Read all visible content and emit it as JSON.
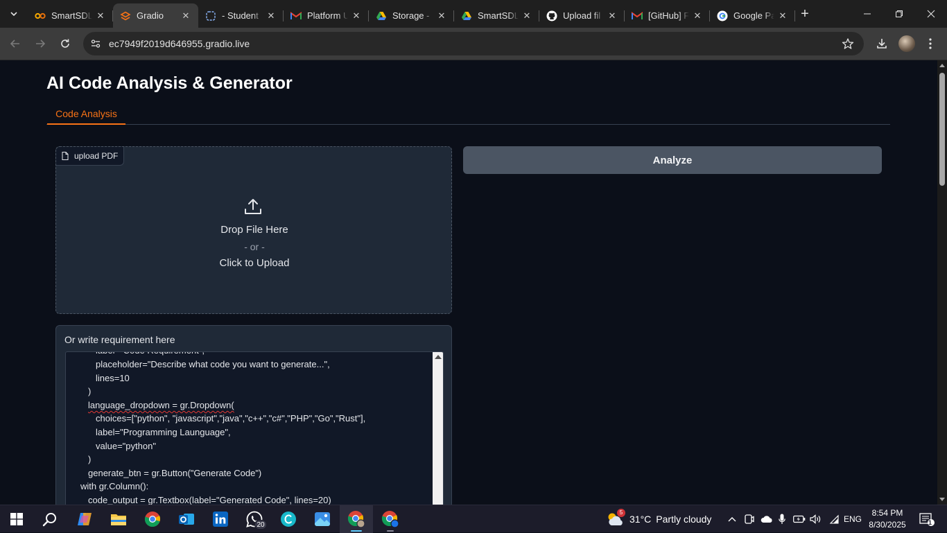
{
  "browser": {
    "tabs": [
      {
        "title": "SmartSDLC",
        "icon": "colab-icon"
      },
      {
        "title": "Gradio",
        "icon": "gradio-icon",
        "active": true
      },
      {
        "title": "- Student",
        "icon": "student-portal-icon"
      },
      {
        "title": "Platform U",
        "icon": "gmail-icon"
      },
      {
        "title": "Storage -",
        "icon": "google-drive-icon"
      },
      {
        "title": "SmartSDLC",
        "icon": "google-drive-icon"
      },
      {
        "title": "Upload fil",
        "icon": "github-icon"
      },
      {
        "title": "[GitHub] F",
        "icon": "gmail-icon"
      },
      {
        "title": "Google Pa",
        "icon": "google-pay-icon"
      }
    ],
    "url": "ec7949f2019d646955.gradio.live"
  },
  "app": {
    "title": "AI Code Analysis & Generator",
    "tabs": [
      {
        "label": "Code Analysis",
        "active": true
      }
    ],
    "upload": {
      "label": "upload PDF",
      "drop_text": "Drop File Here",
      "or_text": "- or -",
      "click_text": "Click to Upload"
    },
    "analyze_button": "Analyze",
    "requirement": {
      "label": "Or write requirement here",
      "lines": [
        "label=\"Code Requirement\",",
        "placeholder=\"Describe what code you want to generate...\",",
        "lines=10",
        ")",
        "language_dropdown = gr.Dropdown(",
        "choices=[\"python\", \"javascript\",\"java\",\"c++\",\"c#\",\"PHP\",\"Go\",\"Rust\"],",
        "label=\"Programming Launguage\",",
        "value=\"python\"",
        ")",
        "generate_btn = gr.Button(\"Generate Code\")",
        "with gr.Column():",
        "code_output = gr.Textbox(label=\"Generated Code\", lines=20)"
      ]
    }
  },
  "taskbar": {
    "apps": [
      "start-icon",
      "search-icon",
      "copilot-icon",
      "file-explorer-icon",
      "chrome-icon",
      "outlook-icon",
      "linkedin-icon",
      "whatsapp-icon",
      "canva-icon",
      "photos-icon",
      "chrome-profile-icon",
      "chrome-profile-2-icon"
    ],
    "whatsapp_badge": "20",
    "weather_badge": "5",
    "temperature": "31°C",
    "weather": "Partly cloudy",
    "language": "ENG",
    "time": "8:54 PM",
    "date": "8/30/2025",
    "notification_count": "1"
  },
  "colors": {
    "accent": "#f97316",
    "page_bg": "#0b0f19",
    "block_bg": "#1f2937",
    "button_bg": "#4b5563"
  }
}
